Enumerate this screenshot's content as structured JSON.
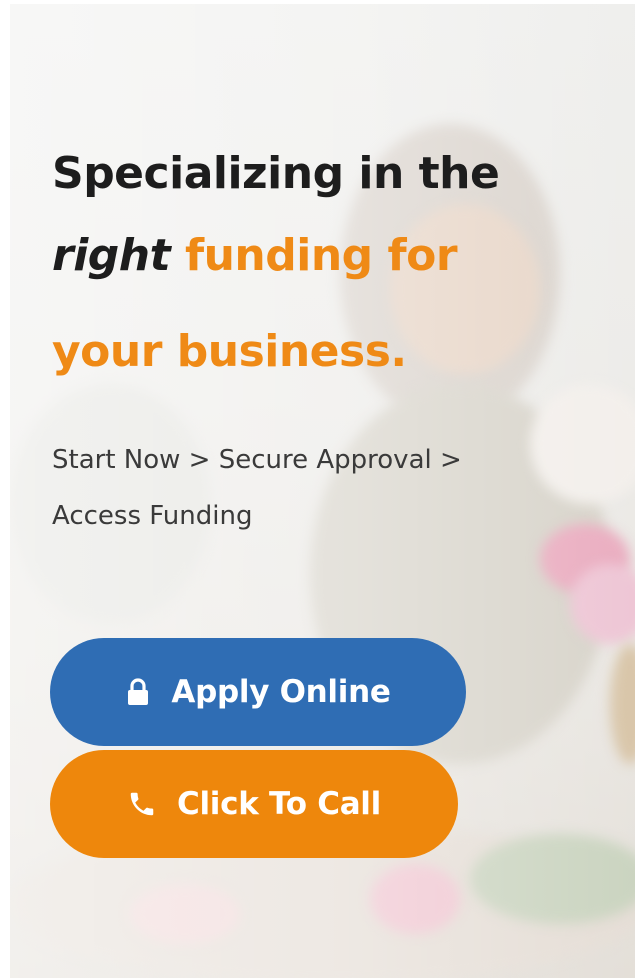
{
  "hero": {
    "headline_line1": "Specializing in the",
    "headline_emphasis": "right",
    "headline_orange_1": "funding for",
    "headline_orange_2": "your business.",
    "steps_text": "Start Now > Secure Approval > Access Funding"
  },
  "buttons": {
    "apply": {
      "label": "Apply Online",
      "icon": "lock-icon"
    },
    "call": {
      "label": "Click To Call",
      "icon": "phone-icon"
    }
  },
  "colors": {
    "accent_orange": "#ef8a16",
    "button_blue": "#2f6db4",
    "button_orange": "#ee870c",
    "headline_dark": "#1d1d1d"
  }
}
